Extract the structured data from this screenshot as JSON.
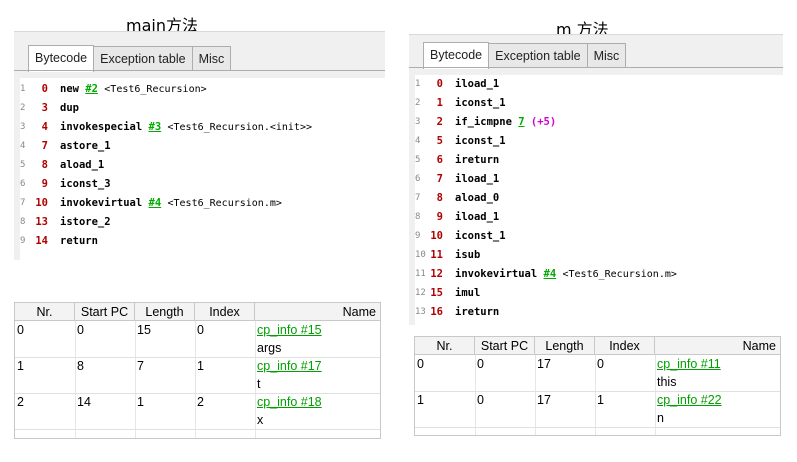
{
  "left": {
    "caption": "main方法",
    "tabs": [
      "Bytecode",
      "Exception table",
      "Misc"
    ],
    "code": [
      {
        "n": "1",
        "pc": "0",
        "op": "new",
        "ref": "#2",
        "cmt": "<Test6_Recursion>"
      },
      {
        "n": "2",
        "pc": "3",
        "op": "dup"
      },
      {
        "n": "3",
        "pc": "4",
        "op": "invokespecial",
        "ref": "#3",
        "cmt": "<Test6_Recursion.<init>>"
      },
      {
        "n": "4",
        "pc": "7",
        "op": "astore_1"
      },
      {
        "n": "5",
        "pc": "8",
        "op": "aload_1"
      },
      {
        "n": "6",
        "pc": "9",
        "op": "iconst_3"
      },
      {
        "n": "7",
        "pc": "10",
        "op": "invokevirtual",
        "ref": "#4",
        "cmt": "<Test6_Recursion.m>"
      },
      {
        "n": "8",
        "pc": "13",
        "op": "istore_2"
      },
      {
        "n": "9",
        "pc": "14",
        "op": "return"
      }
    ],
    "table": {
      "headers": [
        "Nr.",
        "Start PC",
        "Length",
        "Index",
        "Name"
      ],
      "rows": [
        {
          "nr": "0",
          "start": "0",
          "len": "15",
          "idx": "0",
          "link": "cp_info #15",
          "name": "args"
        },
        {
          "nr": "1",
          "start": "8",
          "len": "7",
          "idx": "1",
          "link": "cp_info #17",
          "name": "t"
        },
        {
          "nr": "2",
          "start": "14",
          "len": "1",
          "idx": "2",
          "link": "cp_info #18",
          "name": "x"
        }
      ]
    }
  },
  "right": {
    "caption": "m  方法",
    "tabs": [
      "Bytecode",
      "Exception table",
      "Misc"
    ],
    "code": [
      {
        "n": "1",
        "pc": "0",
        "op": "iload_1"
      },
      {
        "n": "2",
        "pc": "1",
        "op": "iconst_1"
      },
      {
        "n": "3",
        "pc": "2",
        "op": "if_icmpne",
        "ref": "7",
        "jmp": "(+5)"
      },
      {
        "n": "4",
        "pc": "5",
        "op": "iconst_1"
      },
      {
        "n": "5",
        "pc": "6",
        "op": "ireturn"
      },
      {
        "n": "6",
        "pc": "7",
        "op": "iload_1"
      },
      {
        "n": "7",
        "pc": "8",
        "op": "aload_0"
      },
      {
        "n": "8",
        "pc": "9",
        "op": "iload_1"
      },
      {
        "n": "9",
        "pc": "10",
        "op": "iconst_1"
      },
      {
        "n": "10",
        "pc": "11",
        "op": "isub"
      },
      {
        "n": "11",
        "pc": "12",
        "op": "invokevirtual",
        "ref": "#4",
        "cmt": "<Test6_Recursion.m>"
      },
      {
        "n": "12",
        "pc": "15",
        "op": "imul"
      },
      {
        "n": "13",
        "pc": "16",
        "op": "ireturn"
      }
    ],
    "table": {
      "headers": [
        "Nr.",
        "Start PC",
        "Length",
        "Index",
        "Name"
      ],
      "rows": [
        {
          "nr": "0",
          "start": "0",
          "len": "17",
          "idx": "0",
          "link": "cp_info #11",
          "name": "this"
        },
        {
          "nr": "1",
          "start": "0",
          "len": "17",
          "idx": "1",
          "link": "cp_info #22",
          "name": "n"
        }
      ]
    }
  }
}
